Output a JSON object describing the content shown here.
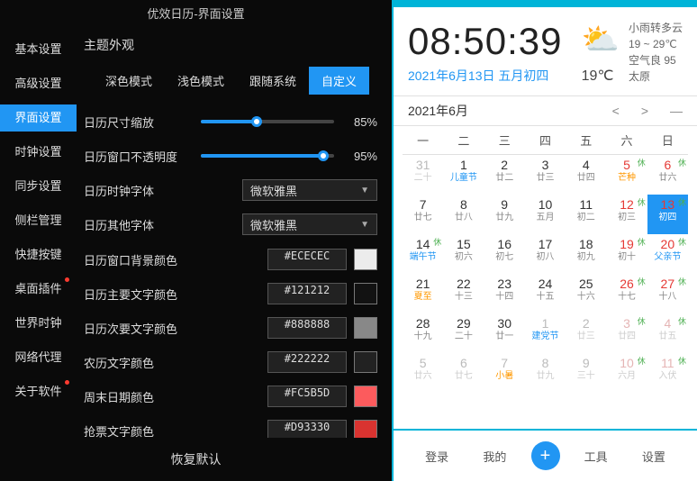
{
  "window_title": "优效日历-界面设置",
  "sidebar": {
    "items": [
      {
        "label": "基本设置"
      },
      {
        "label": "高级设置"
      },
      {
        "label": "界面设置"
      },
      {
        "label": "时钟设置"
      },
      {
        "label": "同步设置"
      },
      {
        "label": "侧栏管理"
      },
      {
        "label": "快捷按键"
      },
      {
        "label": "桌面插件"
      },
      {
        "label": "世界时钟"
      },
      {
        "label": "网络代理"
      },
      {
        "label": "关于软件"
      }
    ],
    "active_index": 2
  },
  "content": {
    "section_title": "主题外观",
    "theme_tabs": [
      "深色模式",
      "浅色模式",
      "跟随系统",
      "自定义"
    ],
    "theme_active": 3,
    "scale": {
      "label": "日历尺寸缩放",
      "value": "85%",
      "pct": 42
    },
    "opacity": {
      "label": "日历窗口不透明度",
      "value": "95%",
      "pct": 92
    },
    "clock_font": {
      "label": "日历时钟字体",
      "value": "微软雅黑"
    },
    "other_font": {
      "label": "日历其他字体",
      "value": "微软雅黑"
    },
    "colors": [
      {
        "label": "日历窗口背景颜色",
        "hex": "#ECECEC",
        "swatch": "#ECECEC"
      },
      {
        "label": "日历主要文字颜色",
        "hex": "#121212",
        "swatch": "#121212"
      },
      {
        "label": "日历次要文字颜色",
        "hex": "#888888",
        "swatch": "#888888"
      },
      {
        "label": "农历文字颜色",
        "hex": "#222222",
        "swatch": "#222222"
      },
      {
        "label": "周末日期颜色",
        "hex": "#FC5B5D",
        "swatch": "#FC5B5D"
      },
      {
        "label": "抢票文字颜色",
        "hex": "#D93330",
        "swatch": "#D93330"
      }
    ],
    "reset": "恢复默认"
  },
  "calendar": {
    "time": "08:50:39",
    "date": "2021年6月13日 五月初四",
    "temp_now": "19℃",
    "weather": {
      "desc": "小雨转多云",
      "range": "19 ~ 29℃",
      "aqi": "空气良 95",
      "city": "太原"
    },
    "month": "2021年6月",
    "weekdays": [
      "一",
      "二",
      "三",
      "四",
      "五",
      "六",
      "日"
    ],
    "days": [
      {
        "n": "31",
        "s": "二十",
        "o": 1
      },
      {
        "n": "1",
        "s": "儿童节",
        "f": 1
      },
      {
        "n": "2",
        "s": "廿二"
      },
      {
        "n": "3",
        "s": "廿三"
      },
      {
        "n": "4",
        "s": "廿四"
      },
      {
        "n": "5",
        "s": "芒种",
        "w": 1,
        "b": 1,
        "f2": 1
      },
      {
        "n": "6",
        "s": "廿六",
        "w": 1,
        "b": 1
      },
      {
        "n": "7",
        "s": "廿七"
      },
      {
        "n": "8",
        "s": "廿八"
      },
      {
        "n": "9",
        "s": "廿九"
      },
      {
        "n": "10",
        "s": "五月"
      },
      {
        "n": "11",
        "s": "初二"
      },
      {
        "n": "12",
        "s": "初三",
        "w": 1,
        "b": 1
      },
      {
        "n": "13",
        "s": "初四",
        "w": 1,
        "b": 1,
        "t": 1
      },
      {
        "n": "14",
        "s": "端午节",
        "b": 1,
        "f": 1
      },
      {
        "n": "15",
        "s": "初六"
      },
      {
        "n": "16",
        "s": "初七"
      },
      {
        "n": "17",
        "s": "初八"
      },
      {
        "n": "18",
        "s": "初九"
      },
      {
        "n": "19",
        "s": "初十",
        "w": 1,
        "b": 1
      },
      {
        "n": "20",
        "s": "父亲节",
        "w": 1,
        "b": 1,
        "f": 1
      },
      {
        "n": "21",
        "s": "夏至",
        "f2": 1
      },
      {
        "n": "22",
        "s": "十三"
      },
      {
        "n": "23",
        "s": "十四"
      },
      {
        "n": "24",
        "s": "十五"
      },
      {
        "n": "25",
        "s": "十六"
      },
      {
        "n": "26",
        "s": "十七",
        "w": 1,
        "b": 1
      },
      {
        "n": "27",
        "s": "十八",
        "w": 1,
        "b": 1
      },
      {
        "n": "28",
        "s": "十九"
      },
      {
        "n": "29",
        "s": "二十"
      },
      {
        "n": "30",
        "s": "廿一"
      },
      {
        "n": "1",
        "s": "建党节",
        "o": 1,
        "f": 1
      },
      {
        "n": "2",
        "s": "廿三",
        "o": 1
      },
      {
        "n": "3",
        "s": "廿四",
        "o": 1,
        "w": 1,
        "b": 1
      },
      {
        "n": "4",
        "s": "廿五",
        "o": 1,
        "w": 1,
        "b": 1
      },
      {
        "n": "5",
        "s": "廿六",
        "o": 1
      },
      {
        "n": "6",
        "s": "廿七",
        "o": 1
      },
      {
        "n": "7",
        "s": "小暑",
        "o": 1,
        "f2": 1
      },
      {
        "n": "8",
        "s": "廿九",
        "o": 1
      },
      {
        "n": "9",
        "s": "三十",
        "o": 1
      },
      {
        "n": "10",
        "s": "六月",
        "o": 1,
        "w": 1,
        "b": 1
      },
      {
        "n": "11",
        "s": "入伏",
        "o": 1,
        "w": 1,
        "b": 1
      }
    ],
    "bottom": {
      "login": "登录",
      "mine": "我的",
      "tools": "工具",
      "settings": "设置"
    }
  }
}
